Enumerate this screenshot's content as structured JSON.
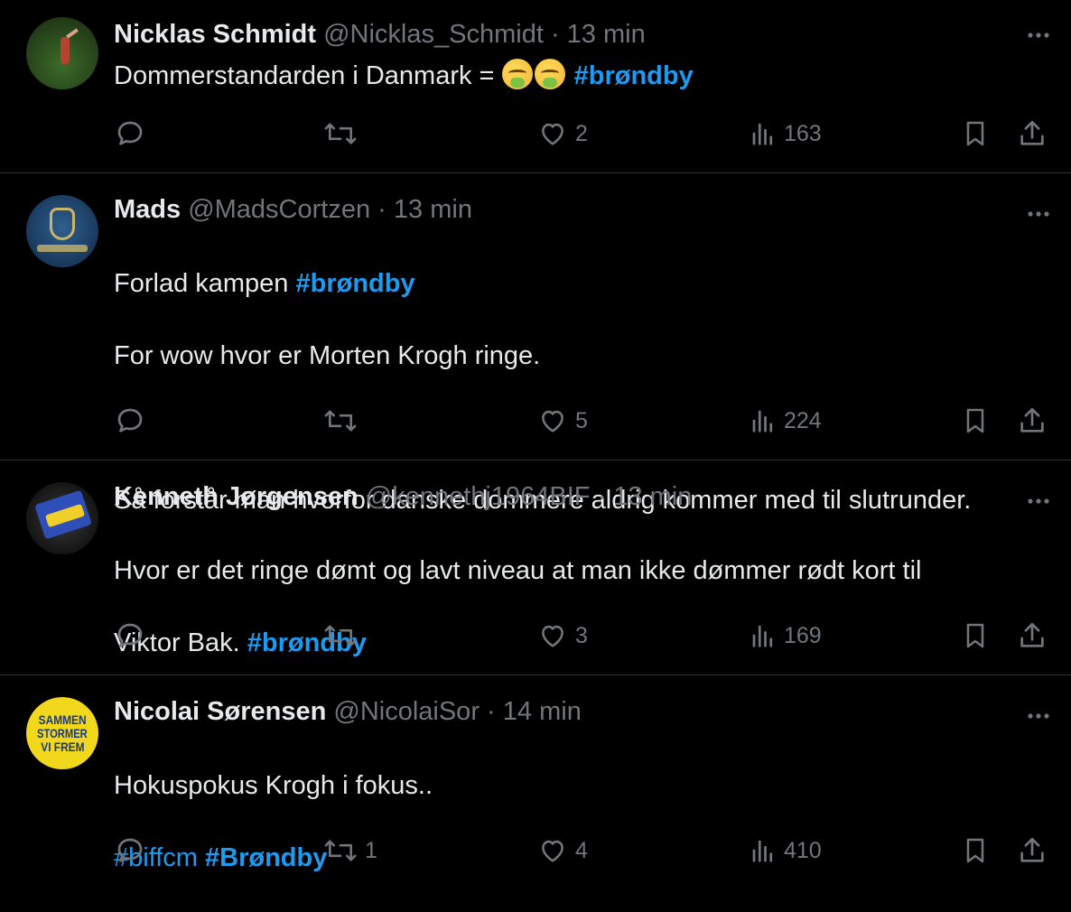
{
  "tweets": [
    {
      "name": "Nicklas Schmidt",
      "handle": "@Nicklas_Schmidt",
      "sep": "·",
      "time": "13 min",
      "lines": [
        {
          "text": "Dommerstandarden i Danmark = ",
          "emoji": "nauseated-face-emoji nauseated-face-emoji",
          "hashtags": [
            "#brøndby"
          ]
        }
      ],
      "replies": "",
      "retweets": "",
      "likes": "2",
      "views": "163"
    },
    {
      "name": "Mads",
      "handle": "@MadsCortzen",
      "sep": "·",
      "time": "13 min",
      "line1": "Forlad kampen ",
      "line1_hashtag": "#brøndby",
      "line2": "For wow hvor er Morten Krogh ringe.",
      "line3": "Så forstår man hvorfor danske dommere aldrig kommer med til slutrunder.",
      "replies": "",
      "retweets": "",
      "likes": "5",
      "views": "224"
    },
    {
      "name": "Kenneth Jørgensen",
      "handle": "@kennethj1964BIF",
      "sep": "·",
      "time": "13 min",
      "line1": "Hvor er det ringe dømt og lavt niveau at man ikke dømmer rødt kort til",
      "line2": "Viktor Bak. ",
      "line2_hashtag": "#brøndby",
      "replies": "",
      "retweets": "",
      "likes": "3",
      "views": "169"
    },
    {
      "name": "Nicolai Sørensen",
      "handle": "@NicolaiSor",
      "sep": "·",
      "time": "14 min",
      "line1": "Hokuspokus Krogh i fokus..",
      "hashtag_a": "#biffcm",
      "hashtag_b": "#Brøndby",
      "avatar_text": [
        "SAMMEN",
        "STORMER",
        "VI FREM"
      ],
      "replies": "",
      "retweets": "1",
      "likes": "4",
      "views": "410"
    }
  ],
  "colors": {
    "background": "#000000",
    "text": "#e7e9ea",
    "muted": "#71767b",
    "link": "#1d9bf0",
    "divider": "#2f3336"
  }
}
